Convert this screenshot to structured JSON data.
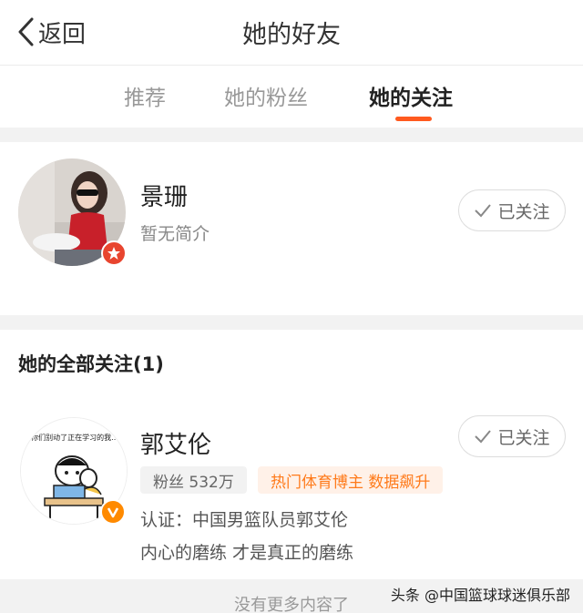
{
  "header": {
    "back_label": "返回",
    "title": "她的好友"
  },
  "tabs": [
    {
      "label": "推荐",
      "active": false
    },
    {
      "label": "她的粉丝",
      "active": false
    },
    {
      "label": "她的关注",
      "active": true
    }
  ],
  "profile": {
    "name": "景珊",
    "bio": "暂无简介",
    "follow_label": "已关注"
  },
  "following": {
    "section_title": "她的全部关注(1)",
    "items": [
      {
        "name": "郭艾伦",
        "avatar_caption": "你们别动了正在学习的我...",
        "fans": "粉丝 532万",
        "tag": "热门体育博主 数据飙升",
        "verification": "认证：中国男篮队员郭艾伦",
        "bio": "内心的磨练 才是真正的磨练",
        "follow_label": "已关注"
      }
    ]
  },
  "footer": {
    "no_more": "没有更多内容了",
    "watermark": "头条 @中国篮球球迷俱乐部"
  },
  "colors": {
    "accent": "#ff5a1f",
    "tag_text": "#ff7a1a",
    "verified": "#ff8a00",
    "star_badge": "#e8452f"
  }
}
